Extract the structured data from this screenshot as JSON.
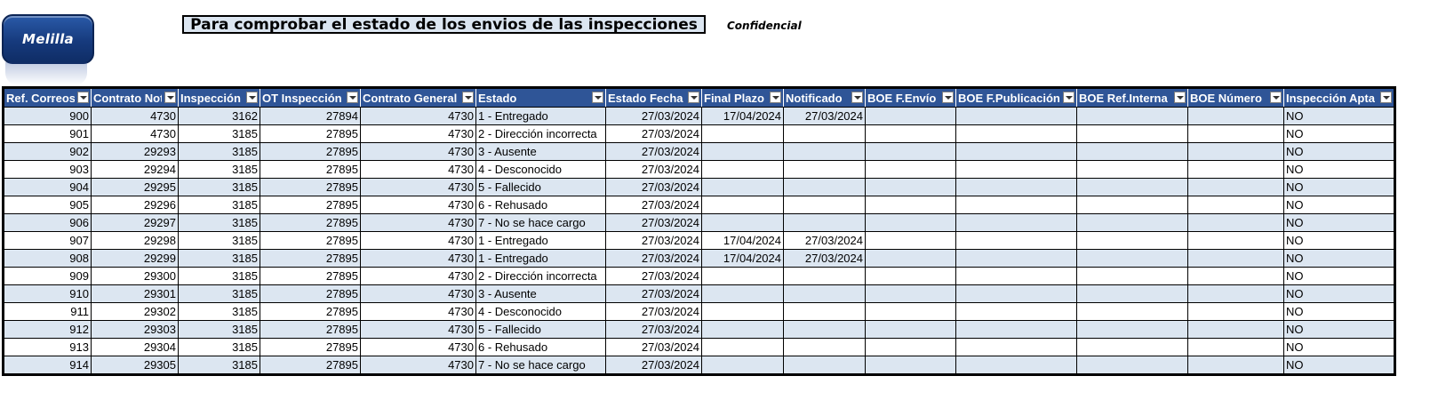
{
  "logo": {
    "text": "Melilla"
  },
  "title": "Para comprobar el estado de los envios de las inspecciones",
  "confidential": "Confidencial",
  "columns": [
    "Ref. Correos",
    "Contrato Not",
    "Inspección",
    "OT Inspección",
    "Contrato General",
    "Estado",
    "Estado Fecha",
    "Final Plazo",
    "Notificado",
    "BOE F.Envío",
    "BOE F.Publicación",
    "BOE Ref.Interna",
    "BOE Número",
    "Inspección Apta"
  ],
  "filter_icon": "dropdown-arrow-icon",
  "colors": {
    "header_bg": "#2f5597",
    "band_bg": "#dce6f1",
    "title_bg": "#dce6f1"
  },
  "rows": [
    [
      "900",
      "4730",
      "3162",
      "27894",
      "4730",
      "1 - Entregado",
      "27/03/2024",
      "17/04/2024",
      "27/03/2024",
      "",
      "",
      "",
      "",
      "NO"
    ],
    [
      "901",
      "4730",
      "3185",
      "27895",
      "4730",
      "2 - Dirección incorrecta",
      "27/03/2024",
      "",
      "",
      "",
      "",
      "",
      "",
      "NO"
    ],
    [
      "902",
      "29293",
      "3185",
      "27895",
      "4730",
      "3 - Ausente",
      "27/03/2024",
      "",
      "",
      "",
      "",
      "",
      "",
      "NO"
    ],
    [
      "903",
      "29294",
      "3185",
      "27895",
      "4730",
      "4 - Desconocido",
      "27/03/2024",
      "",
      "",
      "",
      "",
      "",
      "",
      "NO"
    ],
    [
      "904",
      "29295",
      "3185",
      "27895",
      "4730",
      "5 - Fallecido",
      "27/03/2024",
      "",
      "",
      "",
      "",
      "",
      "",
      "NO"
    ],
    [
      "905",
      "29296",
      "3185",
      "27895",
      "4730",
      "6 - Rehusado",
      "27/03/2024",
      "",
      "",
      "",
      "",
      "",
      "",
      "NO"
    ],
    [
      "906",
      "29297",
      "3185",
      "27895",
      "4730",
      "7 - No se hace cargo",
      "27/03/2024",
      "",
      "",
      "",
      "",
      "",
      "",
      "NO"
    ],
    [
      "907",
      "29298",
      "3185",
      "27895",
      "4730",
      "1 - Entregado",
      "27/03/2024",
      "17/04/2024",
      "27/03/2024",
      "",
      "",
      "",
      "",
      "NO"
    ],
    [
      "908",
      "29299",
      "3185",
      "27895",
      "4730",
      "1 - Entregado",
      "27/03/2024",
      "17/04/2024",
      "27/03/2024",
      "",
      "",
      "",
      "",
      "NO"
    ],
    [
      "909",
      "29300",
      "3185",
      "27895",
      "4730",
      "2 - Dirección incorrecta",
      "27/03/2024",
      "",
      "",
      "",
      "",
      "",
      "",
      "NO"
    ],
    [
      "910",
      "29301",
      "3185",
      "27895",
      "4730",
      "3 - Ausente",
      "27/03/2024",
      "",
      "",
      "",
      "",
      "",
      "",
      "NO"
    ],
    [
      "911",
      "29302",
      "3185",
      "27895",
      "4730",
      "4 - Desconocido",
      "27/03/2024",
      "",
      "",
      "",
      "",
      "",
      "",
      "NO"
    ],
    [
      "912",
      "29303",
      "3185",
      "27895",
      "4730",
      "5 - Fallecido",
      "27/03/2024",
      "",
      "",
      "",
      "",
      "",
      "",
      "NO"
    ],
    [
      "913",
      "29304",
      "3185",
      "27895",
      "4730",
      "6 - Rehusado",
      "27/03/2024",
      "",
      "",
      "",
      "",
      "",
      "",
      "NO"
    ],
    [
      "914",
      "29305",
      "3185",
      "27895",
      "4730",
      "7 - No se hace cargo",
      "27/03/2024",
      "",
      "",
      "",
      "",
      "",
      "",
      "NO"
    ]
  ]
}
